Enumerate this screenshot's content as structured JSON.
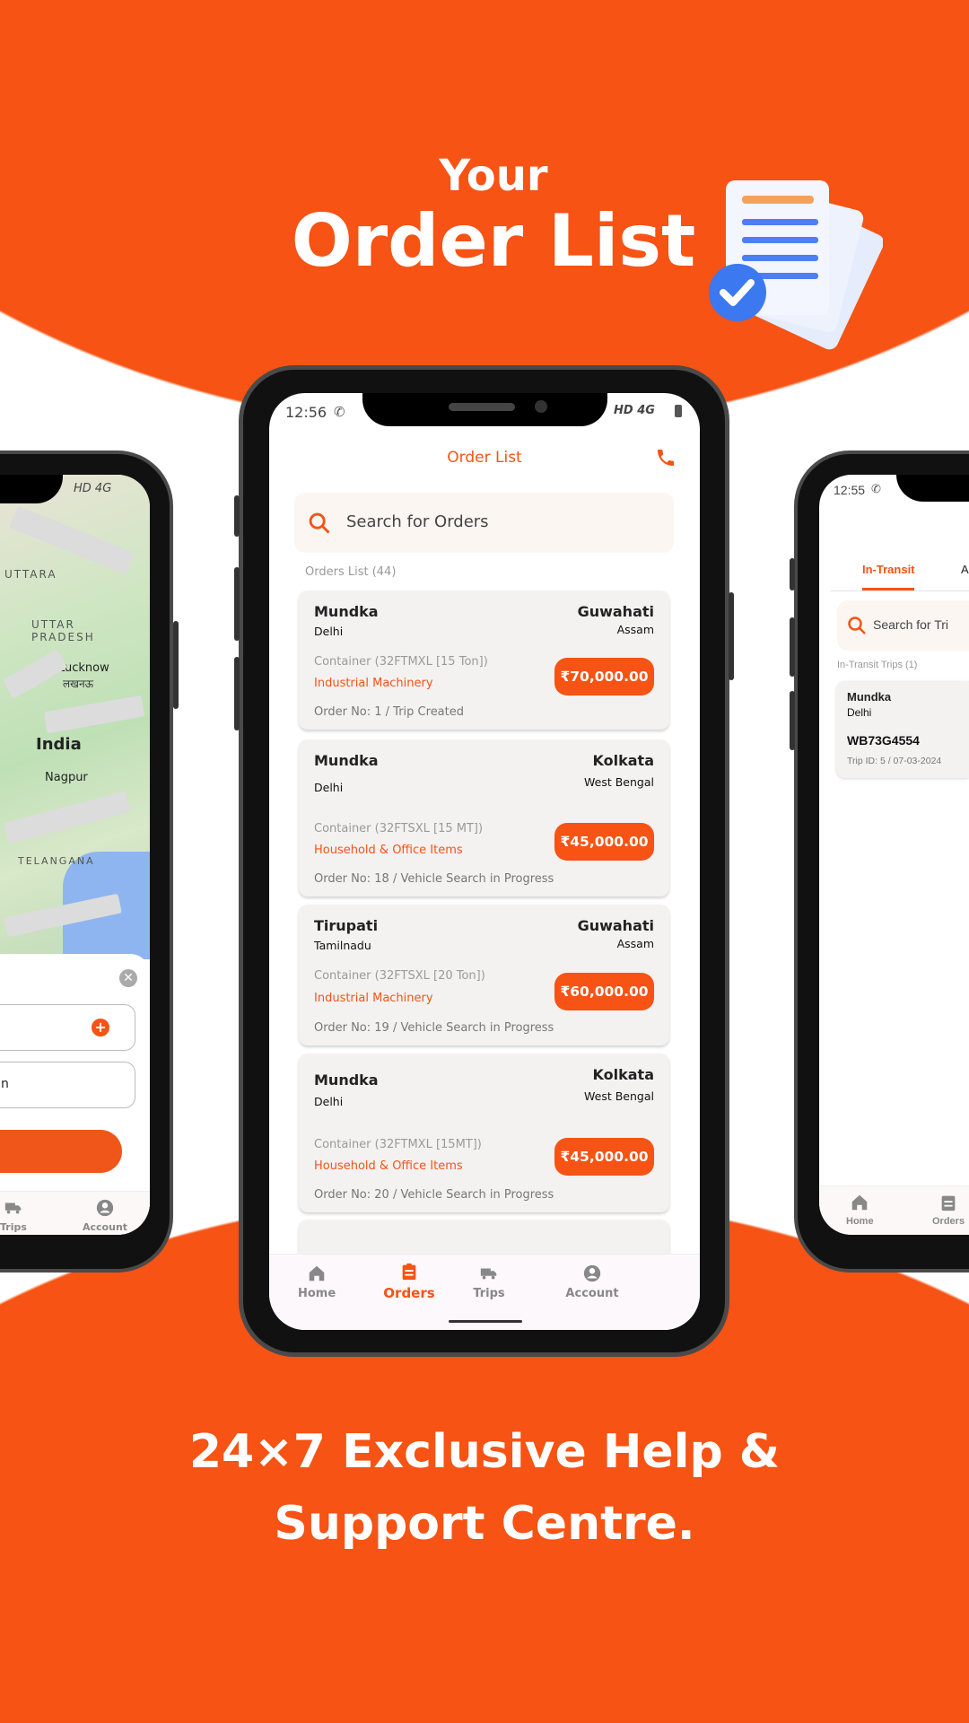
{
  "hero": {
    "line1": "Your",
    "line2": "Order List"
  },
  "footer": {
    "line1": "24×7 Exclusive Help &",
    "line2": "Support Centre."
  },
  "colors": {
    "accent": "#f65314",
    "card": "#f4f1f1",
    "search_bg": "#fcf6f3"
  },
  "center_phone": {
    "status": {
      "time": "12:56",
      "network": "HD 4G"
    },
    "header": {
      "title": "Order List",
      "call_icon": "phone-icon"
    },
    "search": {
      "placeholder": "Search for Orders"
    },
    "list_label": "Orders List (44)",
    "orders": [
      {
        "from": "Mundka",
        "from_state": "Delhi",
        "to": "Guwahati",
        "to_state": "Assam",
        "vehicle": "Container (32FTMXL [15 Ton])",
        "category": "Industrial Machinery",
        "status": "Order No: 1 / Trip Created",
        "price": "₹70,000.00"
      },
      {
        "from": "Mundka",
        "from_state": "Delhi",
        "to": "Kolkata",
        "to_state": "West Bengal",
        "vehicle": "Container (32FTSXL [15 MT])",
        "category": "Household & Office Items",
        "status": "Order No: 18 / Vehicle Search in Progress",
        "price": "₹45,000.00"
      },
      {
        "from": "Tirupati",
        "from_state": "Tamilnadu",
        "to": "Guwahati",
        "to_state": "Assam",
        "vehicle": "Container (32FTSXL [20 Ton])",
        "category": "Industrial Machinery",
        "status": "Order No: 19 / Vehicle Search in Progress",
        "price": "₹60,000.00"
      },
      {
        "from": "Mundka",
        "from_state": "Delhi",
        "to": "Kolkata",
        "to_state": "West Bengal",
        "vehicle": "Container (32FTMXL [15MT])",
        "category": "Household & Office Items",
        "status": "Order No: 20 / Vehicle Search in Progress",
        "price": "₹45,000.00"
      }
    ],
    "nav": [
      {
        "label": "Home",
        "icon": "home-icon"
      },
      {
        "label": "Orders",
        "icon": "clipboard-icon",
        "active": true
      },
      {
        "label": "Trips",
        "icon": "truck-icon"
      },
      {
        "label": "Account",
        "icon": "account-icon"
      }
    ]
  },
  "left_phone": {
    "status": {
      "network": "HD 4G"
    },
    "map_labels": [
      "UTTARA",
      "UTTAR PRADESH",
      "Lucknow",
      "लखनऊ",
      "India",
      "Nagpur",
      "TELANGANA"
    ],
    "input2_fragment": "n",
    "nav": [
      {
        "label": "Trips",
        "icon": "truck-icon"
      },
      {
        "label": "Account",
        "icon": "account-icon"
      }
    ]
  },
  "right_phone": {
    "status": {
      "time": "12:55"
    },
    "tabs": [
      {
        "label": "In-Transit",
        "active": true
      },
      {
        "label": "A"
      }
    ],
    "search": {
      "placeholder": "Search for Tri"
    },
    "list_label": "In-Transit Trips (1)",
    "trip": {
      "from": "Mundka",
      "from_state": "Delhi",
      "vehicle_no": "WB73G4554",
      "meta": "Trip ID: 5 / 07-03-2024"
    },
    "nav": [
      {
        "label": "Home",
        "icon": "home-icon"
      },
      {
        "label": "Orders",
        "icon": "clipboard-icon"
      }
    ]
  }
}
